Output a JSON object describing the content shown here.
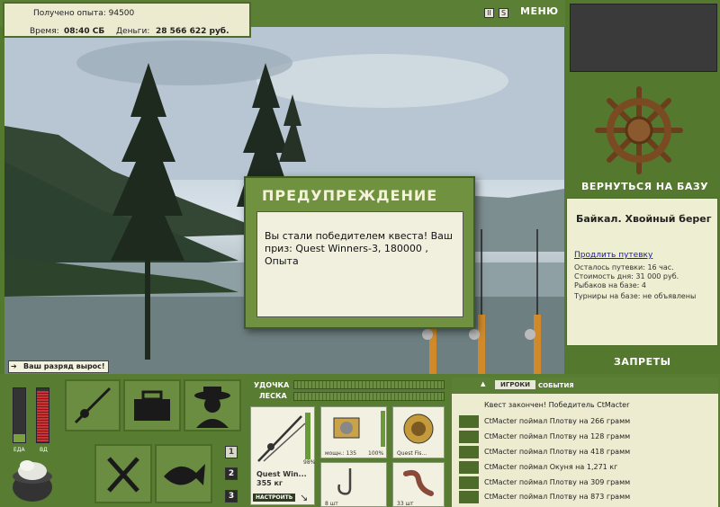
{
  "header": {
    "experience_label": "Получено опыта:",
    "experience_value": "94500",
    "time_label": "Время:",
    "time_value": "08:40 СБ",
    "money_label": "Деньги:",
    "money_value": "28 566 622 руб.",
    "pause_icon": "II",
    "sound_icon": "S",
    "menu_label": "МЕНЮ"
  },
  "scene": {
    "rank_message": "Ваш разряд вырос!"
  },
  "dialog": {
    "title": "ПРЕДУПРЕЖДЕНИЕ",
    "message": "Вы стали победителем квеста! Ваш приз: Quest Winners-3, 180000 , Опыта"
  },
  "sidebar": {
    "return_base": "ВЕРНУТЬСЯ НА БАЗУ",
    "location_title": "Байкал. Хвойный берег",
    "extend_link": "Продлить путевку",
    "lines": [
      "Осталось путевки: 16 час.",
      "Стоимость дня: 31 000 руб.",
      "Рыбаков на базе: 4",
      "Турниры на базе: не объявлены"
    ],
    "bans": "ЗАПРЕТЫ"
  },
  "status": {
    "food_label": "ЕДА",
    "alcohol_label": "ВД",
    "food_level": 0.15,
    "alcohol_level": 0.95
  },
  "pages": [
    "1",
    "2",
    "3"
  ],
  "gear": {
    "rod_label": "УДОЧКА",
    "line_label": "ЛЕСКА",
    "rod_name": "Quest Win...",
    "rod_weight": "355 кг",
    "rod_percent": "98%",
    "tune_button": "НАСТРОИТЬ",
    "reel_power": "мощн.: 135",
    "reel_percent": "100%",
    "line_name": "Quest Fis...",
    "hook_count": "8 шт",
    "bait_count": "33 шт"
  },
  "events": {
    "tab_players": "ИГРОКИ",
    "tab_events": "СОБЫТИЯ",
    "lines": [
      "Квест закончен! Победитель CtMacter",
      "CtMacter поймал Плотву на 266 грамм",
      "CtMacter поймал Плотву на 128 грамм",
      "CtMacter поймал Плотву на 418 грамм",
      "CtMacter поймал Окуня на 1,271 кг",
      "CtMacter поймал Плотву на 309 грамм",
      "CtMacter поймал Плотву на 873 грамм"
    ]
  },
  "colors": {
    "panel_green": "#5b7f34",
    "cream": "#eeecd0",
    "dialog_green": "#6f9140"
  }
}
